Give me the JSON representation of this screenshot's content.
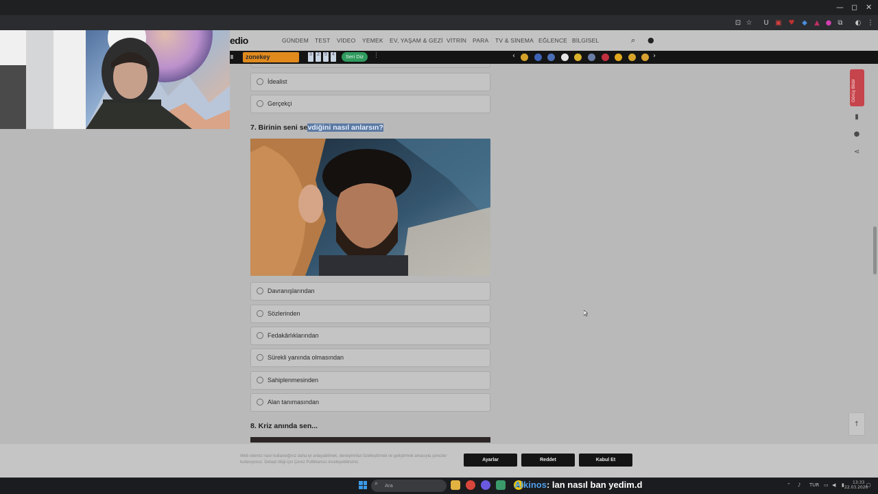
{
  "window_controls": [
    "—",
    "◻",
    "✕"
  ],
  "site": {
    "logo": "edio",
    "nav": [
      "GÜNDEM",
      "TEST",
      "VİDEO",
      "YEMEK",
      "EV, YAŞAM & GEZİ",
      "VİTRİN",
      "PARA",
      "TV & SİNEMA",
      "EĞLENCE",
      "BİLGİSEL"
    ]
  },
  "promo": {
    "zone_label": "zonekey",
    "numbers": [
      "3",
      "2",
      "5",
      "4"
    ],
    "seri_label": "Seri Diz",
    "prev": "‹",
    "next": "›",
    "dot_colors": [
      "#d4a22a",
      "#3d63b8",
      "#4a6fb5",
      "#e5e5e5",
      "#d9b12c",
      "#6a7da6",
      "#c03040",
      "#e0a81e",
      "#d6a42a",
      "#d8a030"
    ]
  },
  "quiz": {
    "prev_options": [
      "İdealist",
      "Gerçekçi"
    ],
    "q7": {
      "title_plain": "7. Birinin seni se",
      "title_highlight": "vdiğini nasıl anlarsın?",
      "options": [
        "Davranışlarından",
        "Sözlerinden",
        "Fedakârlıklarından",
        "Sürekli yanında olmasından",
        "Sahiplenmesinden",
        "Alan tanımasından"
      ]
    },
    "q8": {
      "title": "8. Kriz anında sen..."
    }
  },
  "side": {
    "badge": "Görüş Bildir",
    "up": "↑"
  },
  "cookie": {
    "text": "Web sitemiz nasıl kullandığınız daha iyi anlayabilmek, deneyiminizi özelleştirmek ve geliştirmek amacıyla çerezler kullanıyoruz. Detaylı bilgi için Çerez Politikamızı inceleyebilirsiniz.",
    "settings": "Ayarlar",
    "reject": "Reddet",
    "accept": "Kabul Et"
  },
  "taskbar": {
    "search_placeholder": "Ara",
    "chat_badge": "1",
    "chat_user": "Alkinos",
    "chat_message": ": lan nasıl ban yedim.d",
    "lang": "TUR",
    "time": "13:33",
    "date": "22.03.2026"
  },
  "colors": {
    "accent_red": "#c6444b",
    "highlight": "#5b79a3",
    "button_dark": "#141414"
  }
}
